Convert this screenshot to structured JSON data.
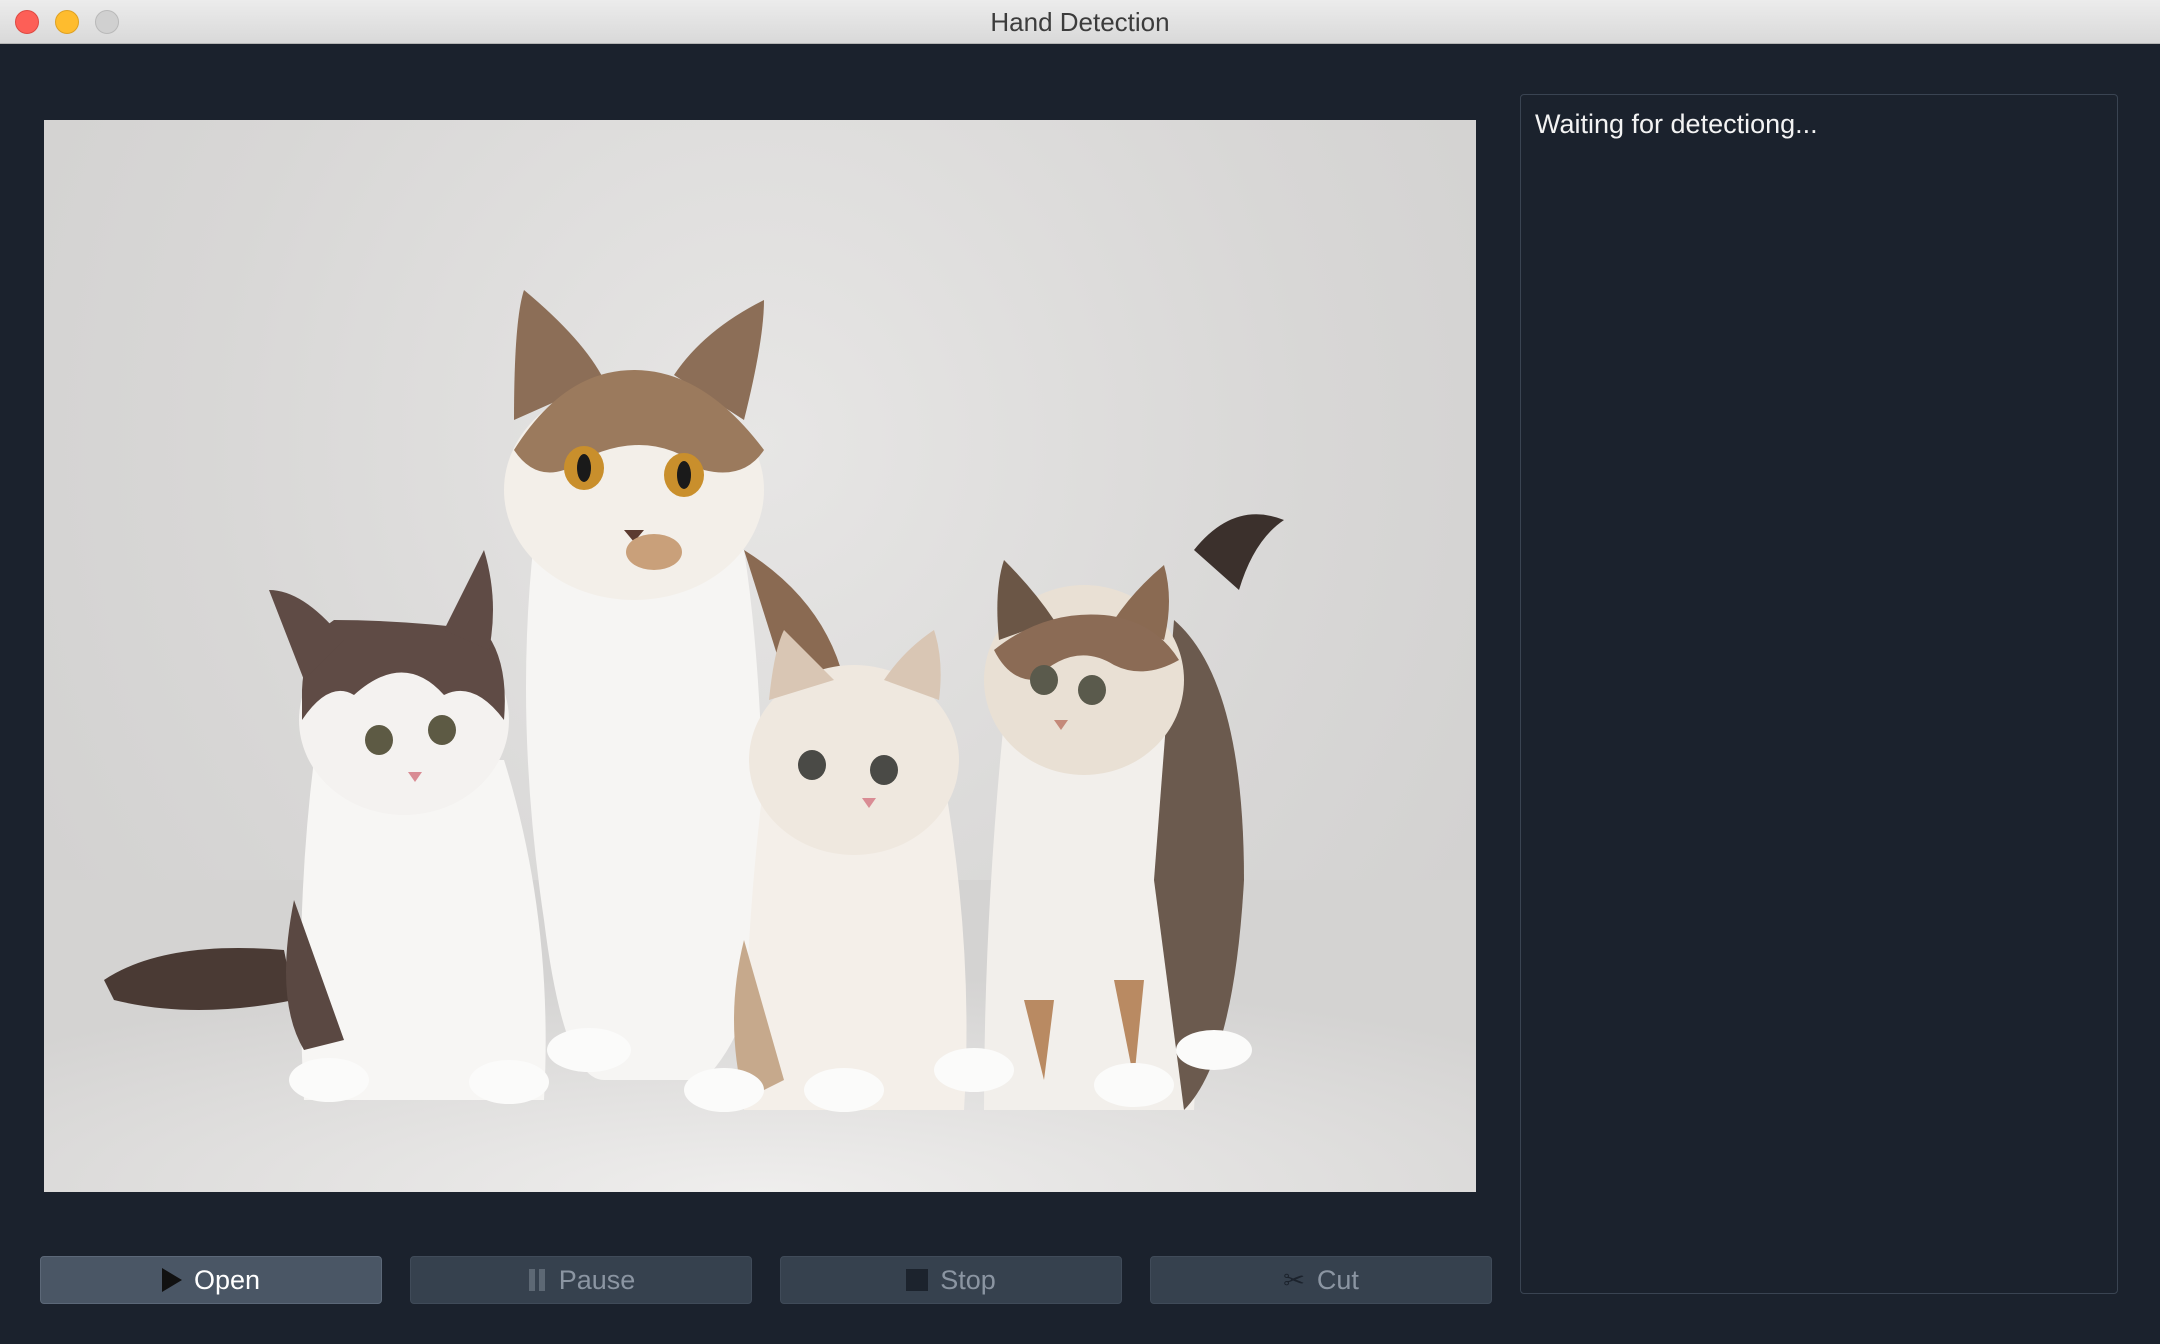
{
  "window": {
    "title": "Hand Detection"
  },
  "viewer": {
    "image_alt": "cat with three kittens"
  },
  "log": {
    "status_text": "Waiting for detectiong..."
  },
  "toolbar": {
    "open_label": "Open",
    "pause_label": "Pause",
    "stop_label": "Stop",
    "cut_label": "Cut"
  },
  "icons": {
    "open": "play-icon",
    "pause": "pause-icon",
    "stop": "stop-icon",
    "cut": "scissors-icon"
  },
  "colors": {
    "background": "#1b222d",
    "button_active": "#4a5665",
    "button_disabled": "#36414e",
    "close": "#fd5f57",
    "minimize": "#febc2e",
    "maximize": "#d0d0d0"
  }
}
